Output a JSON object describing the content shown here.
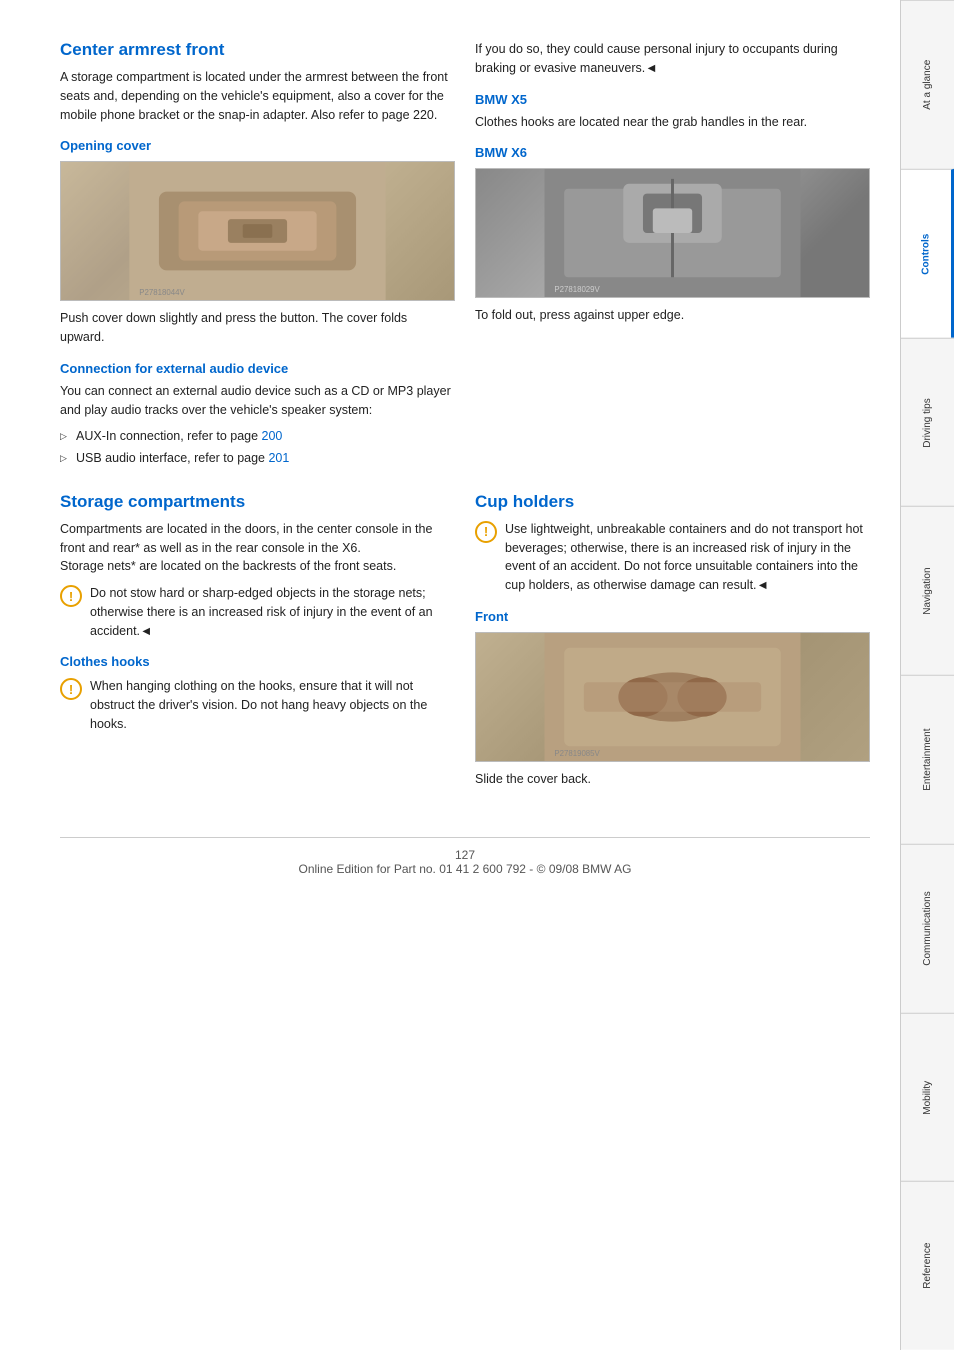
{
  "sidebar": {
    "tabs": [
      {
        "id": "at-a-glance",
        "label": "At a glance",
        "active": false
      },
      {
        "id": "controls",
        "label": "Controls",
        "active": true
      },
      {
        "id": "driving-tips",
        "label": "Driving tips",
        "active": false
      },
      {
        "id": "navigation",
        "label": "Navigation",
        "active": false
      },
      {
        "id": "entertainment",
        "label": "Entertainment",
        "active": false
      },
      {
        "id": "communications",
        "label": "Communications",
        "active": false
      },
      {
        "id": "mobility",
        "label": "Mobility",
        "active": false
      },
      {
        "id": "reference",
        "label": "Reference",
        "active": false
      }
    ]
  },
  "sections": {
    "center_armrest": {
      "title": "Center armrest front",
      "intro": "A storage compartment is located under the armrest between the front seats and, depending on the vehicle's equipment, also a cover for the mobile phone bracket or the snap-in adapter. Also refer to page 220.",
      "opening_cover": {
        "subtitle": "Opening cover",
        "image_alt": "Center armrest image",
        "caption": "Push cover down slightly and press the button. The cover folds upward."
      },
      "connection_audio": {
        "subtitle": "Connection for external audio device",
        "intro": "You can connect an external audio device such as a CD or MP3 player and play audio tracks over the vehicle's speaker system:",
        "bullets": [
          {
            "text": "AUX-In connection, refer to page 200"
          },
          {
            "text": "USB audio interface, refer to page 201"
          }
        ]
      }
    },
    "storage_compartments": {
      "title": "Storage compartments",
      "intro": "Compartments are located in the doors, in the center console in the front and rear* as well as in the rear console in the X6.\nStorage nets* are located on the backrests of the front seats.",
      "warning": "Do not stow hard or sharp-edged objects in the storage nets; otherwise there is an increased risk of injury in the event of an accident.◄",
      "clothes_hooks": {
        "subtitle": "Clothes hooks",
        "warning": "When hanging clothing on the hooks, ensure that it will not obstruct the driver's vision. Do not hang heavy objects on the hooks.",
        "right_col_text": "If you do so, they could cause personal injury to occupants during braking or evasive maneuvers.◄",
        "bmwx5": {
          "subtitle": "BMW X5",
          "text": "Clothes hooks are located near the grab handles in the rear."
        },
        "bmwx6": {
          "subtitle": "BMW X6",
          "image_alt": "BMW X6 clothes hook image",
          "caption": "To fold out, press against upper edge.",
          "watermark": "P27818029V"
        }
      }
    },
    "cup_holders": {
      "title": "Cup holders",
      "warning": "Use lightweight, unbreakable containers and do not transport hot beverages; otherwise, there is an increased risk of injury in the event of an accident. Do not force unsuitable containers into the cup holders, as otherwise damage can result.◄",
      "front": {
        "subtitle": "Front",
        "image_alt": "Cup holder front image",
        "caption": "Slide the cover back.",
        "watermark": "P27819085V"
      }
    }
  },
  "footer": {
    "page_number": "127",
    "text": "Online Edition for Part no. 01 41 2 600 792 - © 09/08 BMW AG"
  }
}
